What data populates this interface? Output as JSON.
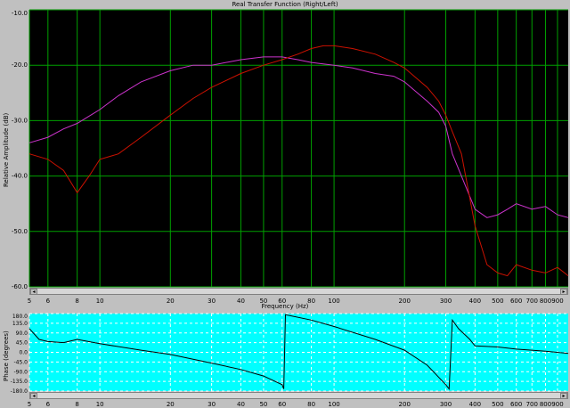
{
  "window": {
    "title": "Real Transfer Function (Right/Left)"
  },
  "controls": {
    "icons": [
      "zoom-icon",
      "marker-up-icon",
      "marker-down-icon"
    ]
  },
  "top_chart": {
    "ylabel": "Relative Amplitude (dB)",
    "xlabel": "Frequency (Hz)",
    "ytick_labels": [
      "-10.0",
      "-20.0",
      "-30.0",
      "-40.0",
      "-50.0",
      "-60.0"
    ]
  },
  "bottom_chart": {
    "ylabel": "Phase (degrees)",
    "ytick_labels": [
      "180.0",
      "135.0",
      "90.0",
      "45.0",
      "0.0",
      "-45.0",
      "-90.0",
      "-135.0",
      "-180.0"
    ]
  },
  "x_tick_labels": [
    "5",
    "6",
    "8",
    "10",
    "20",
    "30",
    "40",
    "50",
    "60",
    "80",
    "100",
    "200",
    "300",
    "400",
    "500",
    "600",
    "700",
    "800",
    "900"
  ],
  "colors": {
    "top_bg": "#000000",
    "bottom_bg": "#00ffff",
    "grid_top": "#00a000",
    "grid_bottom": "#ffffff",
    "magenta": "#cc33cc",
    "red": "#cc1100",
    "yellow": "#ffcc00",
    "phase_line": "#000000"
  },
  "chart_data": [
    {
      "type": "line",
      "title": "Real Transfer Function (Right/Left)",
      "xlabel": "Frequency (Hz)",
      "ylabel": "Relative Amplitude (dB)",
      "xscale": "log",
      "xlim": [
        5,
        1000
      ],
      "ylim": [
        -60,
        -10
      ],
      "grid": true,
      "series": [
        {
          "color": "#cc33cc",
          "x": [
            5,
            6,
            7,
            8,
            10,
            12,
            15,
            20,
            25,
            30,
            40,
            50,
            60,
            70,
            80,
            100,
            120,
            150,
            180,
            200,
            220,
            250,
            280,
            300,
            320,
            350,
            400,
            450,
            500,
            550,
            600,
            700,
            800,
            900,
            1000
          ],
          "y": [
            -34,
            -33,
            -31.5,
            -30.5,
            -28,
            -25.5,
            -23,
            -21,
            -20,
            -20,
            -19,
            -18.5,
            -18.5,
            -19,
            -19.5,
            -20,
            -20.5,
            -21.5,
            -22,
            -23,
            -24.5,
            -26.5,
            -28.5,
            -31,
            -36,
            -40,
            -46,
            -47.5,
            -47,
            -46,
            -45,
            -46,
            -45.5,
            -47,
            -47.5
          ]
        },
        {
          "color": "#cc1100",
          "x": [
            5,
            6,
            7,
            8,
            9,
            10,
            12,
            15,
            20,
            25,
            30,
            40,
            50,
            60,
            70,
            80,
            90,
            100,
            120,
            150,
            180,
            200,
            220,
            250,
            280,
            300,
            320,
            350,
            400,
            450,
            500,
            550,
            600,
            700,
            800,
            900,
            1000
          ],
          "y": [
            -36,
            -37,
            -39,
            -43,
            -40,
            -37,
            -36,
            -33,
            -29,
            -26,
            -24,
            -21.5,
            -20,
            -19,
            -18,
            -17,
            -16.5,
            -16.5,
            -17,
            -18,
            -19.5,
            -20.5,
            -22,
            -24,
            -26.5,
            -29,
            -32,
            -36,
            -49,
            -56,
            -57.5,
            -58,
            -56,
            -57,
            -57.5,
            -56.5,
            -58
          ]
        }
      ]
    },
    {
      "type": "line",
      "xlabel": "",
      "ylabel": "Phase (degrees)",
      "xscale": "log",
      "xlim": [
        5,
        1000
      ],
      "ylim": [
        -180,
        180
      ],
      "grid": true,
      "series": [
        {
          "color": "#000000",
          "x": [
            5,
            5.5,
            6,
            7,
            8,
            10,
            15,
            20,
            30,
            40,
            50,
            60,
            61,
            62,
            80,
            100,
            150,
            200,
            250,
            300,
            310,
            320,
            340,
            380,
            400,
            500,
            600,
            800,
            1000
          ],
          "y": [
            110,
            60,
            50,
            45,
            60,
            40,
            10,
            -10,
            -50,
            -80,
            -110,
            -150,
            -170,
            175,
            150,
            120,
            60,
            10,
            -60,
            -150,
            -170,
            150,
            110,
            60,
            30,
            25,
            15,
            5,
            -5
          ]
        }
      ]
    }
  ]
}
